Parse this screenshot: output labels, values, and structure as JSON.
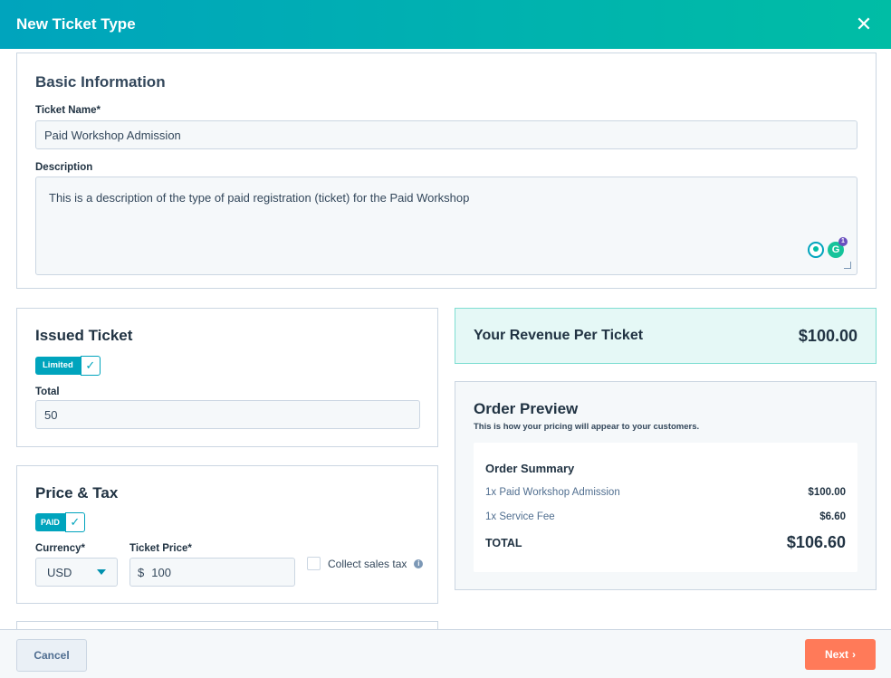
{
  "modal": {
    "title": "New Ticket Type",
    "close_icon": "close-icon"
  },
  "basic": {
    "heading": "Basic Information",
    "name_label": "Ticket Name*",
    "name_value": "Paid Workshop Admission",
    "description_label": "Description",
    "description_value": "This is a description of the type of paid registration (ticket) for the Paid Workshop",
    "grammarly_badge": "1"
  },
  "issued": {
    "heading": "Issued Ticket",
    "toggle_label": "Limited",
    "total_label": "Total",
    "total_value": "50"
  },
  "price": {
    "heading": "Price & Tax",
    "toggle_label": "PAID",
    "currency_label": "Currency*",
    "currency_value": "USD",
    "price_label": "Ticket Price*",
    "currency_symbol": "$",
    "price_value": "100",
    "tax_label": "Collect sales tax"
  },
  "revenue": {
    "label": "Your Revenue Per Ticket",
    "value": "$100.00"
  },
  "preview": {
    "heading": "Order Preview",
    "subtitle": "This is how your pricing will appear to your customers.",
    "summary_title": "Order Summary",
    "items": [
      {
        "label": "1x Paid Workshop Admission",
        "amount": "$100.00"
      },
      {
        "label": "1x Service Fee",
        "amount": "$6.60"
      }
    ],
    "total_label": "TOTAL",
    "total_value": "$106.60"
  },
  "footer": {
    "cancel_label": "Cancel",
    "next_label": "Next"
  },
  "colors": {
    "header_start": "#00a4bd",
    "header_end": "#00bda5",
    "accent": "#00a4bd",
    "next_button": "#ff7a59"
  }
}
